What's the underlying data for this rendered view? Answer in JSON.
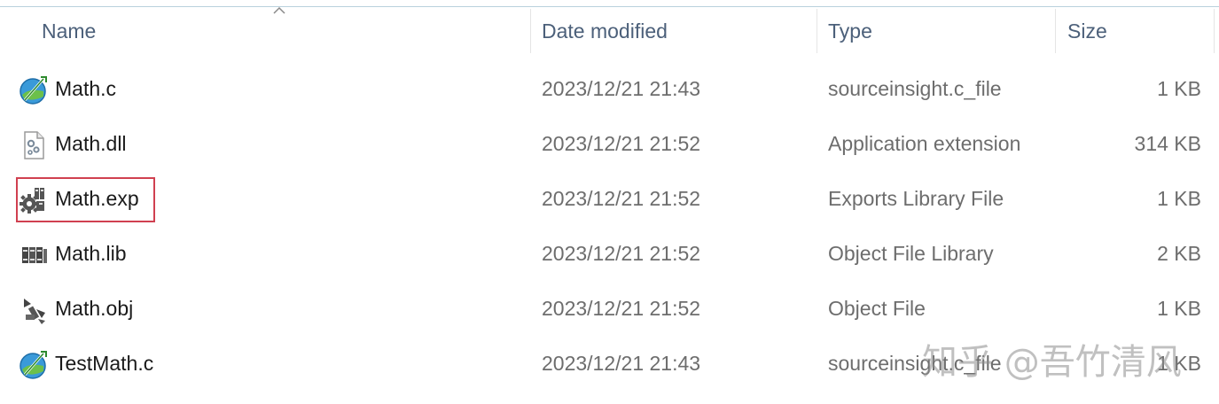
{
  "columns": {
    "name": "Name",
    "date_modified": "Date modified",
    "type": "Type",
    "size": "Size"
  },
  "files": [
    {
      "name": "Math.c",
      "date": "2023/12/21 21:43",
      "type": "sourceinsight.c_file",
      "size": "1 KB",
      "icon": "source-insight-c-icon"
    },
    {
      "name": "Math.dll",
      "date": "2023/12/21 21:52",
      "type": "Application extension",
      "size": "314 KB",
      "icon": "dll-gear-file-icon"
    },
    {
      "name": "Math.exp",
      "date": "2023/12/21 21:52",
      "type": "Exports Library File",
      "size": "1 KB",
      "icon": "exports-library-gear-icon"
    },
    {
      "name": "Math.lib",
      "date": "2023/12/21 21:52",
      "type": "Object File Library",
      "size": "2 KB",
      "icon": "library-books-icon"
    },
    {
      "name": "Math.obj",
      "date": "2023/12/21 21:52",
      "type": "Object File",
      "size": "1 KB",
      "icon": "object-file-icon"
    },
    {
      "name": "TestMath.c",
      "date": "2023/12/21 21:43",
      "type": "sourceinsight.c_file",
      "size": "1 KB",
      "icon": "source-insight-c-icon"
    }
  ],
  "highlighted_file": "Math.exp",
  "highlight_color": "#d04050",
  "watermark": "知乎 @吾竹清风"
}
